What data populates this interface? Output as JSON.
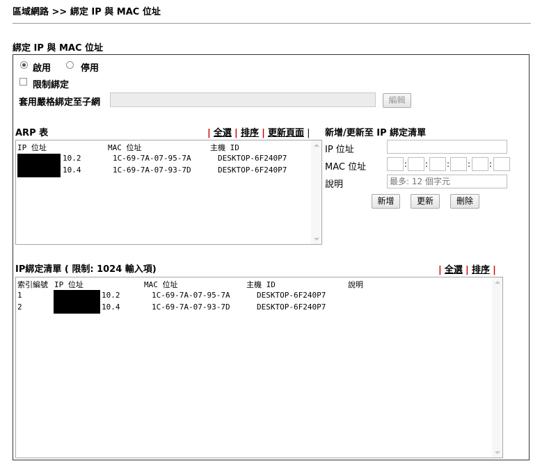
{
  "breadcrumb": "區域網路 >> 綁定 IP 與 MAC 位址",
  "section_title": "綁定 IP 與 MAC 位址",
  "mode": {
    "enable_label": "啟用",
    "disable_label": "停用",
    "selected": "enable"
  },
  "strict_bind": {
    "label": "限制綁定",
    "checked": false
  },
  "subnet": {
    "label": "套用嚴格綁定至子網",
    "value": "",
    "edit_button": "編輯"
  },
  "arp": {
    "title": "ARP 表",
    "links": {
      "select_all": "全選",
      "sort": "排序",
      "refresh": "更新頁面"
    },
    "headers": {
      "ip": "IP 位址",
      "mac": "MAC 位址",
      "host": "主機 ID"
    },
    "rows": [
      {
        "ip": "10.2",
        "mac": "1C-69-7A-07-95-7A",
        "host": "DESKTOP-6F240P7"
      },
      {
        "ip": "10.4",
        "mac": "1C-69-7A-07-93-7D",
        "host": "DESKTOP-6F240P7"
      }
    ]
  },
  "add_update": {
    "title": "新增/更新至 IP 綁定清單",
    "ip_label": "IP 位址",
    "mac_label": "MAC 位址",
    "comment_label": "說明",
    "comment_placeholder": "最多: 12 個字元",
    "buttons": {
      "add": "新增",
      "update": "更新",
      "delete": "刪除"
    }
  },
  "bind_list": {
    "title": "IP綁定清單 ( 限制: 1024 輸入項)",
    "links": {
      "select_all": "全選",
      "sort": "排序"
    },
    "headers": {
      "index": "索引編號",
      "ip": "IP 位址",
      "mac": "MAC 位址",
      "host": "主機 ID",
      "comment": "說明"
    },
    "rows": [
      {
        "index": "1",
        "ip": "10.2",
        "mac": "1C-69-7A-07-95-7A",
        "host": "DESKTOP-6F240P7",
        "comment": ""
      },
      {
        "index": "2",
        "ip": "10.4",
        "mac": "1C-69-7A-07-93-7D",
        "host": "DESKTOP-6F240P7",
        "comment": ""
      }
    ]
  }
}
